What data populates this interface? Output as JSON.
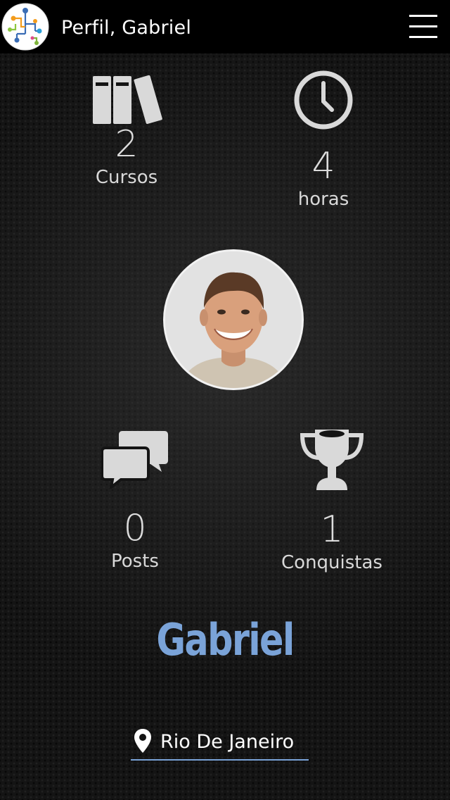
{
  "header": {
    "title": "Perfil, Gabriel",
    "logo_icon": "network-tree-logo-icon",
    "menu_icon": "hamburger-menu-icon"
  },
  "stats": {
    "cursos": {
      "value": "2",
      "label": "Cursos",
      "icon": "books-icon"
    },
    "horas": {
      "value": "4",
      "label": "horas",
      "icon": "clock-icon"
    },
    "posts": {
      "value": "0",
      "label": "Posts",
      "icon": "chat-bubbles-icon"
    },
    "conquistas": {
      "value": "1",
      "label": "Conquistas",
      "icon": "trophy-icon"
    }
  },
  "profile": {
    "avatar_icon": "user-avatar-photo",
    "name": "Gabriel",
    "location": "Rio De Janeiro",
    "location_icon": "map-pin-icon"
  },
  "colors": {
    "accent": "#7aa3d8",
    "topbar": "#000000",
    "background": "#141414",
    "icon_gray": "#d9d9d9"
  }
}
